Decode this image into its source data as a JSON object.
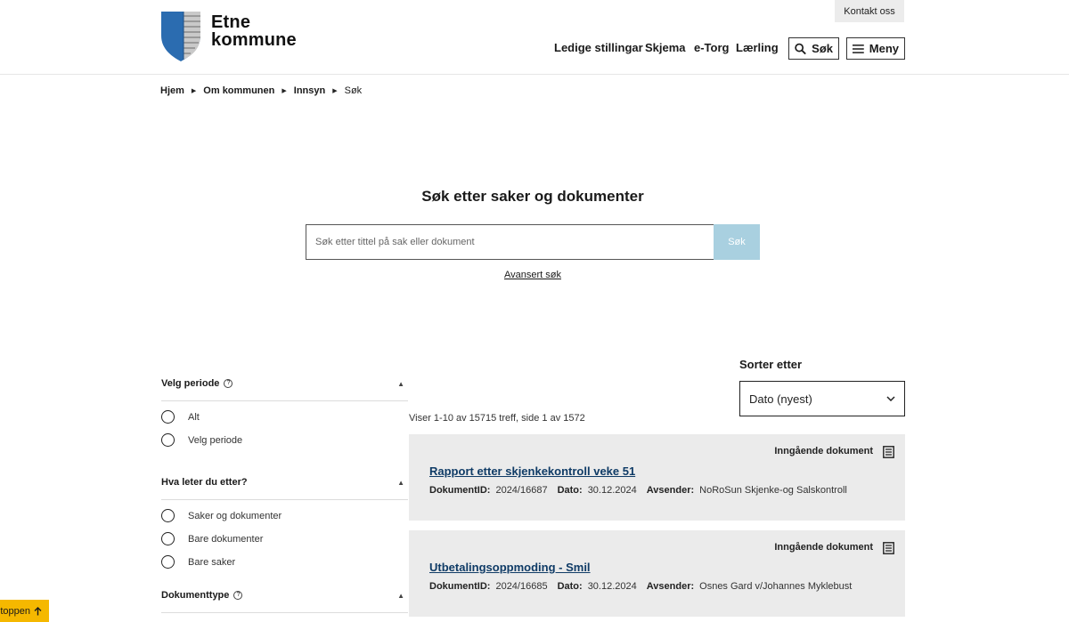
{
  "header": {
    "logo_line1": "Etne",
    "logo_line2": "kommune",
    "contact": "Kontakt oss",
    "nav": [
      "Ledige stillingar",
      "Skjema",
      "e-Torg",
      "Lærling"
    ],
    "search_label": "Søk",
    "menu_label": "Meny",
    "colors": {
      "shield_blue": "#2b6cb0",
      "shield_stripes": "#c9c9c9"
    }
  },
  "breadcrumb": [
    "Hjem",
    "Om kommunen",
    "Innsyn",
    "Søk"
  ],
  "search": {
    "title": "Søk etter saker og dokumenter",
    "placeholder": "Søk etter tittel på sak eller dokument",
    "button": "Søk",
    "advanced": "Avansert søk"
  },
  "filters": {
    "period": {
      "title": "Velg periode",
      "options": [
        "Alt",
        "Velg periode"
      ]
    },
    "what": {
      "title": "Hva leter du etter?",
      "options": [
        "Saker og dokumenter",
        "Bare dokumenter",
        "Bare saker"
      ]
    },
    "doctype": {
      "title": "Dokumenttype"
    }
  },
  "sort": {
    "label": "Sorter etter",
    "selected": "Dato (nyest)"
  },
  "results": {
    "count_text": "Viser 1-10 av 15715 treff, side 1 av 1572",
    "labels": {
      "id": "DokumentID:",
      "date": "Dato:",
      "sender": "Avsender:"
    },
    "items": [
      {
        "type": "Inngående dokument",
        "title": "Rapport etter skjenkekontroll veke 51",
        "id": "2024/16687",
        "date": "30.12.2024",
        "sender": "NoRoSun Skjenke-og Salskontroll"
      },
      {
        "type": "Inngående dokument",
        "title": "Utbetalingsoppmoding - Smil",
        "id": "2024/16685",
        "date": "30.12.2024",
        "sender": "Osnes Gard v/Johannes Myklebust"
      }
    ]
  },
  "to_top": "toppen"
}
